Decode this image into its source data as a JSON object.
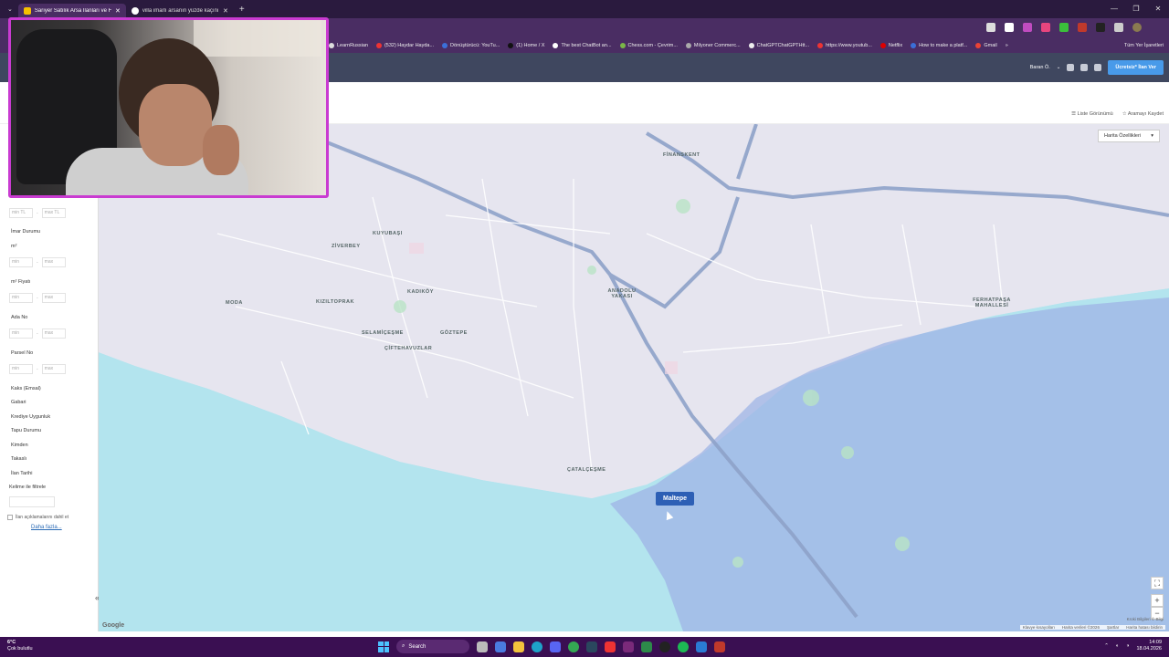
{
  "browser": {
    "tabs": [
      {
        "title": "Sarıyer Satılık Arsa İlanları ve Fi",
        "active": true
      },
      {
        "title": "villa imarlı arsanın yüzde kaçını",
        "active": false
      }
    ],
    "bookmarks": [
      "LearnRussian",
      "(532) Haydar Hayda...",
      "Dönüştürücü: YouTu...",
      "(1) Home / X",
      "The best ChatBot an...",
      "Chess.com - Çevrim...",
      "Milyoner Commerc...",
      "ChatGPTChatGPTHtt...",
      "https://www.youtub...",
      "Netflix",
      "How to make a platf...",
      "Gmail",
      "»"
    ],
    "bookmarks_right": "Tüm Yer İşaretleri"
  },
  "site": {
    "user": "Baran Ö.",
    "post_button": "Ücretsiz* İlan Ver",
    "list_view": "Liste Görünümü",
    "save_search": "Aramayı Kaydet"
  },
  "sidebar": {
    "price_min": "min TL",
    "price_max": "max TL",
    "zoning": "İmar Durumu",
    "m2": "m²",
    "min": "min",
    "max": "max",
    "m2_price": "m² Fiyatı",
    "block_no": "Ada No",
    "parcel_no": "Parsel No",
    "filters": [
      "Kaks (Emsal)",
      "Gabari",
      "Krediye Uygunluk",
      "Tapu Durumu",
      "Kimden",
      "Takaslı",
      "İlan Tarihi"
    ],
    "keyword_label": "Kelime ile filtrele",
    "include_desc": "İlan açıklamalarını dahil et",
    "more": "Daha fazla..."
  },
  "map": {
    "type_select": "Harita Özellikleri",
    "labels": [
      "FİNANSKENT",
      "KUYUBAŞI",
      "ZİVERBEY",
      "KADIKÖY",
      "KIZILTOPRAK",
      "MODA",
      "SELAMİÇEŞME",
      "GÖZTEPE",
      "ÇİFTEHAVUZLAR",
      "ANADOLU YAKASI",
      "FERHATPAŞA MAHALLESİ",
      "ÇATALÇEŞME"
    ],
    "region_tip": "Maltepe",
    "google": "Google",
    "attribution": [
      "Klavye kısayolları",
      "Harita verileri ©2026",
      "Şartlar",
      "Harita hatası bildirin"
    ],
    "data_note": "Kroki Bilgileri © Bilgi"
  },
  "taskbar": {
    "temp": "6°C",
    "weather": "Çok bulutlu",
    "search": "Search",
    "time": "14:09",
    "date": "18.04.2026"
  }
}
